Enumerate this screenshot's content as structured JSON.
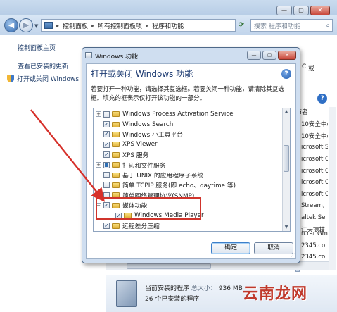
{
  "control_panel": {
    "window_buttons": [
      "—",
      "▢",
      "✕"
    ],
    "address": [
      "控制面板",
      "所有控制面板项",
      "程序和功能"
    ],
    "search_placeholder": "搜索 程序和功能",
    "sidebar": {
      "home": "控制面板主页",
      "view_updates": "查看已安装的更新",
      "toggle_features": "打开或关闭 Windows"
    },
    "main_fragments": {
      "f1": "C",
      "f2": "或"
    },
    "right_header": "布者",
    "right_items": [
      "10安全中心",
      "10安全中心",
      "icrosoft Sy",
      "icrosoft C",
      "icrosoft C",
      "icrosoft C",
      "icrosoft C",
      "Stream, ",
      "altek Se",
      "江天提技"
    ],
    "right_lower": [
      "n.rar Gm",
      "2345.co",
      "2345.co",
      "2345.co"
    ],
    "status": {
      "title": "当前安装的程序",
      "size_label": "总大小：",
      "size": "936 MB",
      "count": "26 个已安装的程序"
    },
    "watermark": "云南龙网"
  },
  "dialog": {
    "title": "Windows 功能",
    "heading": "打开或关闭 Windows 功能",
    "description": "若要打开一种功能，请选择其复选框。若要关闭一种功能，请清除其复选框。填充的框表示仅打开该功能的一部分。",
    "features": [
      {
        "label": "Windows Process Activation Service",
        "state": "off",
        "expandable": true,
        "level": 0
      },
      {
        "label": "Windows Search",
        "state": "on",
        "expandable": false,
        "level": 0
      },
      {
        "label": "Windows 小工具平台",
        "state": "on",
        "expandable": false,
        "level": 0
      },
      {
        "label": "XPS Viewer",
        "state": "on",
        "expandable": false,
        "level": 0
      },
      {
        "label": "XPS 服务",
        "state": "on",
        "expandable": false,
        "level": 0
      },
      {
        "label": "打印和文件服务",
        "state": "partial",
        "expandable": true,
        "level": 0
      },
      {
        "label": "基于 UNIX 的应用程序子系统",
        "state": "off",
        "expandable": false,
        "level": 0
      },
      {
        "label": "简单 TCPIP 服务(即 echo、daytime 等)",
        "state": "off",
        "expandable": false,
        "level": 0
      },
      {
        "label": "简单网络管理协议(SNMP)",
        "state": "off",
        "expandable": true,
        "level": 0
      },
      {
        "label": "媒体功能",
        "state": "on",
        "expandable": true,
        "expanded": true,
        "level": 0
      },
      {
        "label": "Windows Media Player",
        "state": "on",
        "expandable": false,
        "level": 1
      },
      {
        "label": "远程差分压缩",
        "state": "on",
        "expandable": false,
        "level": 0
      }
    ],
    "ok_label": "确定",
    "cancel_label": "取消"
  }
}
